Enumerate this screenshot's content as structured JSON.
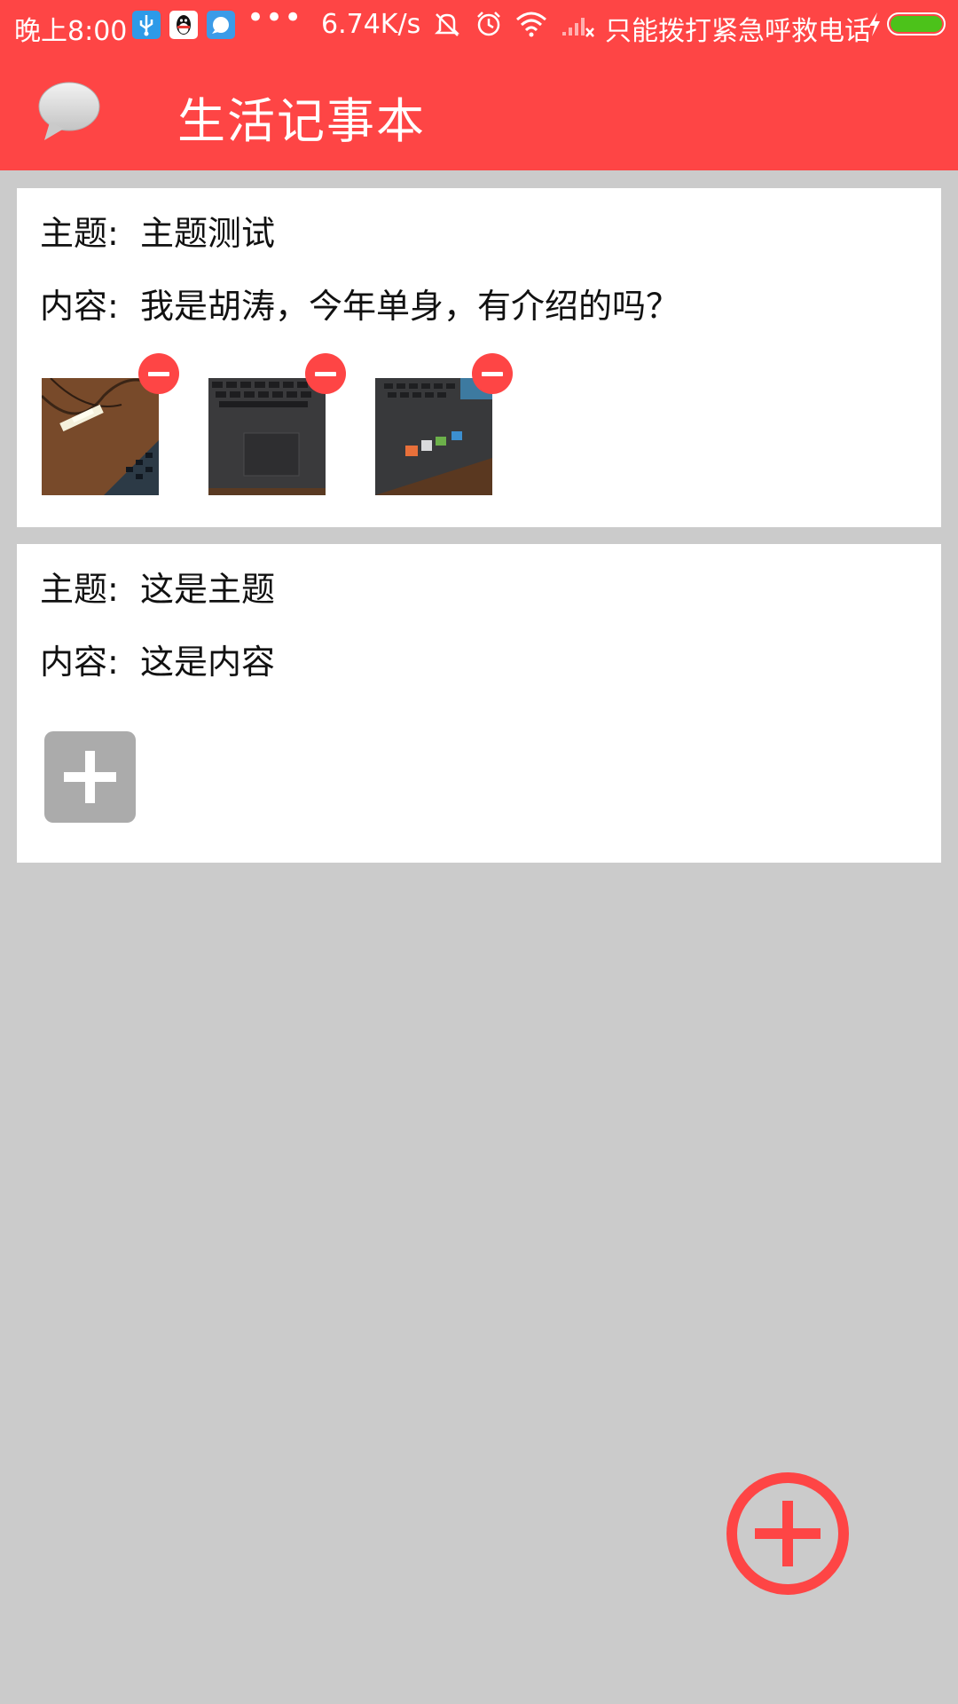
{
  "status_bar": {
    "time": "晚上8:00",
    "overflow": "•••",
    "net_speed": "6.74K/s",
    "carrier": "只能拨打紧急呼救电话",
    "icons": [
      "usb-icon",
      "qq-icon",
      "message-app-icon",
      "mute-icon",
      "alarm-icon",
      "wifi-icon",
      "signal-icon",
      "charging-icon",
      "battery-icon"
    ]
  },
  "app_bar": {
    "icon": "speech-bubble-icon",
    "title": "生活记事本"
  },
  "notes": [
    {
      "subject_label": "主题:",
      "subject": "主题测试",
      "content_label": "内容:",
      "content": "我是胡涛，今年单身，有介绍的吗？",
      "photos": [
        "laptop-photo-1",
        "laptop-photo-2",
        "laptop-photo-3"
      ]
    },
    {
      "subject_label": "主题:",
      "subject": "这是主题",
      "content_label": "内容:",
      "content": "这是内容",
      "photos": []
    }
  ],
  "fab": {
    "icon": "add-circle-icon"
  },
  "colors": {
    "primary": "#fe4545",
    "background": "#cbcbcb",
    "card": "#ffffff",
    "add_photo_tile": "#ababab"
  }
}
